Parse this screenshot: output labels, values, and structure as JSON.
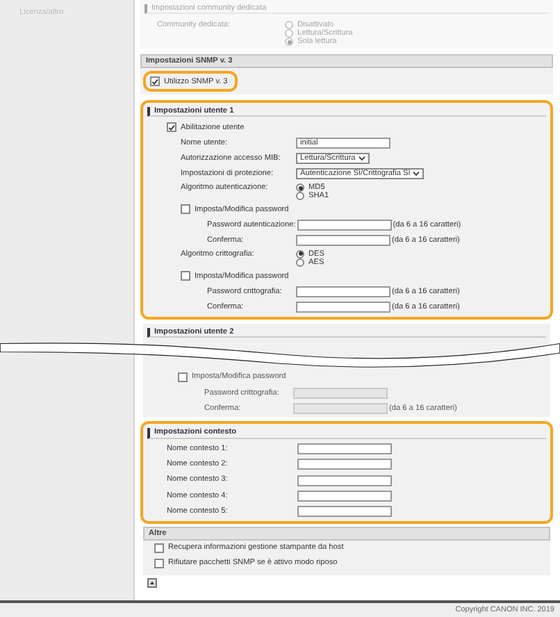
{
  "sidebar": {
    "items": [
      {
        "label": "Licenza/altro"
      }
    ]
  },
  "community": {
    "title": "Impostazioni community dedicata",
    "disabled": true,
    "label": "Community dedicata:",
    "options": [
      {
        "label": "Disattivato",
        "selected": false
      },
      {
        "label": "Lettura/Scrittura",
        "selected": false
      },
      {
        "label": "Sola lettura",
        "selected": true
      }
    ]
  },
  "snmp_v3": {
    "title": "Impostazioni SNMP v. 3",
    "checkbox": {
      "label": "Utilizzo SNMP v. 3",
      "checked": true
    },
    "highlighted": true
  },
  "user_1": {
    "title": "Impostazioni utente 1",
    "highlighted": true,
    "disabled": false,
    "enable": {
      "label": "Abilitazione utente",
      "checked": true
    },
    "rows": [
      {
        "kind": "text",
        "label": "Nome utente:",
        "value": "initial"
      },
      {
        "kind": "select",
        "label": "Autorizzazione accesso MIB:",
        "value": "Lettura/Scrittura"
      },
      {
        "kind": "select",
        "label": "Impostazioni di protezione:",
        "value": "Autenticazione Sì/Crittografia Sì"
      },
      {
        "kind": "radio",
        "label": "Algoritmo autenticazione:",
        "options": [
          {
            "label": "MD5",
            "selected": true
          },
          {
            "label": "SHA1",
            "selected": false
          }
        ]
      },
      {
        "kind": "checkbox",
        "label": "Imposta/Modifica password",
        "checked": false,
        "children": [
          {
            "kind": "password",
            "label": "Password autenticazione:",
            "hint": "(da 6 a 16 caratteri)"
          },
          {
            "kind": "password",
            "label": "Conferma:",
            "hint": "(da 6 a 16 caratteri)"
          }
        ]
      },
      {
        "kind": "radio",
        "label": "Algoritmo crittografia:",
        "options": [
          {
            "label": "DES",
            "selected": true
          },
          {
            "label": "AES",
            "selected": false
          }
        ]
      },
      {
        "kind": "checkbox",
        "label": "Imposta/Modifica password",
        "checked": false,
        "children": [
          {
            "kind": "password",
            "label": "Password crittografia:",
            "hint": "(da 6 a 16 caratteri)"
          },
          {
            "kind": "password",
            "label": "Conferma:",
            "hint": "(da 6 a 16 caratteri)"
          }
        ]
      }
    ]
  },
  "user_2": {
    "title": "Impostazioni utente 2",
    "highlighted": false,
    "disabled": true,
    "rows": [
      {
        "kind": "checkbox",
        "label": "Imposta/Modifica password",
        "checked": false,
        "children": [
          {
            "kind": "password",
            "label": "Password crittografia:"
          },
          {
            "kind": "password",
            "label": "Conferma:",
            "hint": "(da 6 a 16 caratteri)"
          }
        ]
      }
    ]
  },
  "context": {
    "title": "Impostazioni contesto",
    "highlighted": true,
    "disabled": false,
    "rows": [
      {
        "kind": "text",
        "label": "Nome contesto 1:",
        "value": ""
      },
      {
        "kind": "text",
        "label": "Nome contesto 2:",
        "value": ""
      },
      {
        "kind": "text",
        "label": "Nome contesto 3:",
        "value": ""
      },
      {
        "kind": "text",
        "label": "Nome contesto 4:",
        "value": ""
      },
      {
        "kind": "text",
        "label": "Nome contesto 5:",
        "value": ""
      }
    ]
  },
  "others": {
    "title": "Altre",
    "items": [
      {
        "label": "Recupera informazioni gestione stampante da host",
        "checked": false
      },
      {
        "label": "Rifiutare pacchetti SNMP se è attivo modo riposo",
        "checked": false
      }
    ]
  },
  "copyright": "Copyright CANON INC. 2019"
}
